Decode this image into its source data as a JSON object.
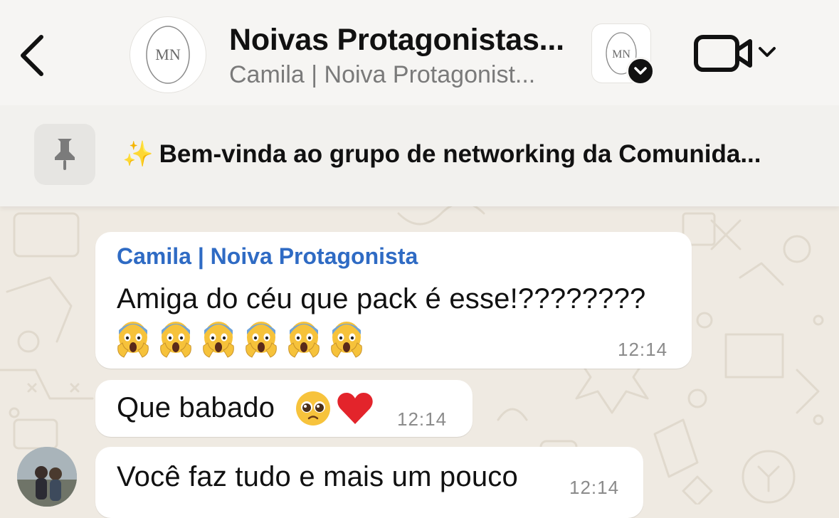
{
  "header": {
    "title": "Noivas Protagonistas...",
    "subtitle": "Camila | Noiva Protagonist...",
    "group_avatar_text": "MN",
    "community_thumb_text": "MN"
  },
  "pinned": {
    "sparkle": "✨",
    "text": "Bem-vinda ao grupo de networking da Comunida..."
  },
  "messages": [
    {
      "sender": "Camila | Noiva Protagonista",
      "text": "Amiga do céu que pack é esse!????????",
      "emoji_count": 6,
      "emoji_name": "screaming-face",
      "time": "12:14"
    },
    {
      "text": "Que babado",
      "emojis": [
        "pleading-face",
        "red-heart"
      ],
      "time": "12:14"
    },
    {
      "text": "Você faz tudo e mais um pouco",
      "time": "12:14"
    }
  ],
  "colors": {
    "sender_name": "#2f6bc4",
    "chat_background": "#efeae2",
    "bubble": "#ffffff",
    "sparkle": "#f2c230"
  }
}
